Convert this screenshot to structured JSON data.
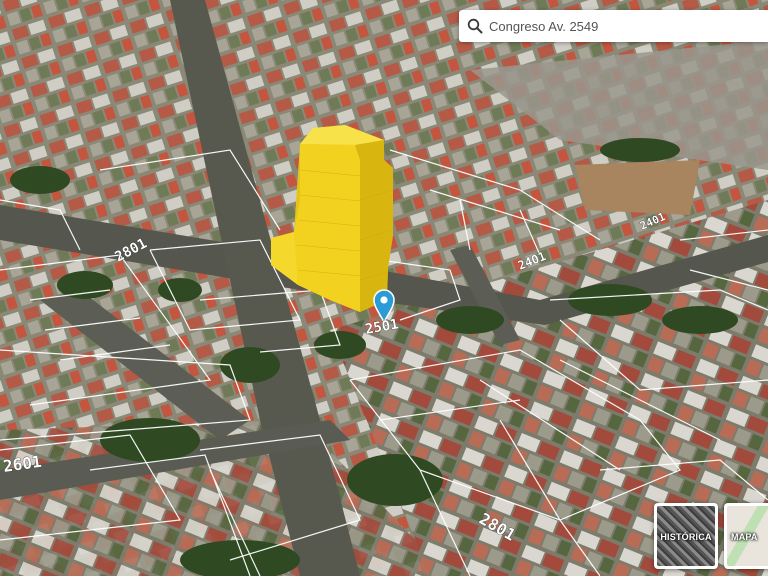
{
  "search": {
    "value": "Congreso Av. 2549",
    "icon": "search-icon"
  },
  "street_numbers": {
    "n2801_left": "2801",
    "n2601": "2601",
    "n2501": "2501",
    "n2401_center": "2401",
    "n2401_right": "2401",
    "n2801_bottom": "2801"
  },
  "layers": {
    "historic_label": "HISTÓRICA",
    "map_label": "MAPA"
  },
  "colors": {
    "building_volume": "#f2d21f",
    "marker": "#2b9bd6",
    "parcel_lines": "#ffffff"
  }
}
